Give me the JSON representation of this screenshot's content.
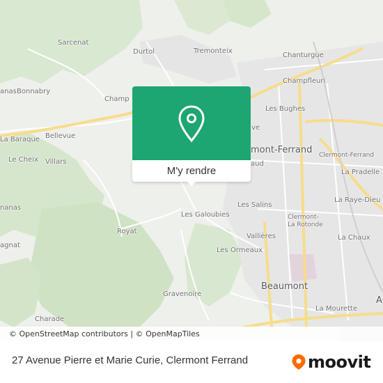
{
  "map": {
    "places": [
      {
        "id": "sarcenat",
        "label": "Sarcenat"
      },
      {
        "id": "durtol",
        "label": "Durtol"
      },
      {
        "id": "tremonteix",
        "label": "Tremonteix"
      },
      {
        "id": "chanturgue",
        "label": "Chanturgue"
      },
      {
        "id": "champfleuri",
        "label": "Champfleuri"
      },
      {
        "id": "bonnabry",
        "label": "Bonnabry"
      },
      {
        "id": "champ",
        "label": "Champ"
      },
      {
        "id": "anas",
        "label": "anas"
      },
      {
        "id": "les-bughes",
        "label": "Les Bughes"
      },
      {
        "id": "bellevue",
        "label": "Bellevue"
      },
      {
        "id": "la-baraque",
        "label": "La Baraque"
      },
      {
        "id": "clermont-ferrand-city",
        "label": "mont-Ferrand"
      },
      {
        "id": "clermont-ferrand-station",
        "label": "Clermont-Ferrand"
      },
      {
        "id": "le-cheix",
        "label": "Le Cheix"
      },
      {
        "id": "villars",
        "label": "Villars"
      },
      {
        "id": "aud",
        "label": "aud"
      },
      {
        "id": "la-pradelle",
        "label": "La Pradelle"
      },
      {
        "id": "la-raye-dieu",
        "label": "La Raye-Dieu"
      },
      {
        "id": "les-salins",
        "label": "Les Salins"
      },
      {
        "id": "nanas",
        "label": "nanas"
      },
      {
        "id": "les-galoubies",
        "label": "Les Galoubies"
      },
      {
        "id": "clermont-la-rotonde",
        "label": "Clermont-\nLa Rotonde"
      },
      {
        "id": "royat",
        "label": "Royat"
      },
      {
        "id": "vallieres",
        "label": "Vallières"
      },
      {
        "id": "la-chaux",
        "label": "La Chaux"
      },
      {
        "id": "agnat",
        "label": "agnat"
      },
      {
        "id": "les-ormeaux",
        "label": "Les Ormeaux"
      },
      {
        "id": "beaumont",
        "label": "Beaumont"
      },
      {
        "id": "gravenoire",
        "label": "Gravenoire"
      },
      {
        "id": "la-mourette",
        "label": "La Mourette"
      },
      {
        "id": "charade",
        "label": "Charade"
      },
      {
        "id": "ve",
        "label": "ve"
      },
      {
        "id": "a-edge",
        "label": "A"
      }
    ],
    "attribution": "© OpenStreetMap contributors | © OpenMapTiles"
  },
  "popup": {
    "action_label": "M'y rendre",
    "pin_icon": "location-pin-icon",
    "header_color": "#1ea672"
  },
  "footer": {
    "address": "27 Avenue Pierre et Marie Curie, Clermont Ferrand",
    "brand": "moovit",
    "brand_color": "#ff6a00"
  }
}
